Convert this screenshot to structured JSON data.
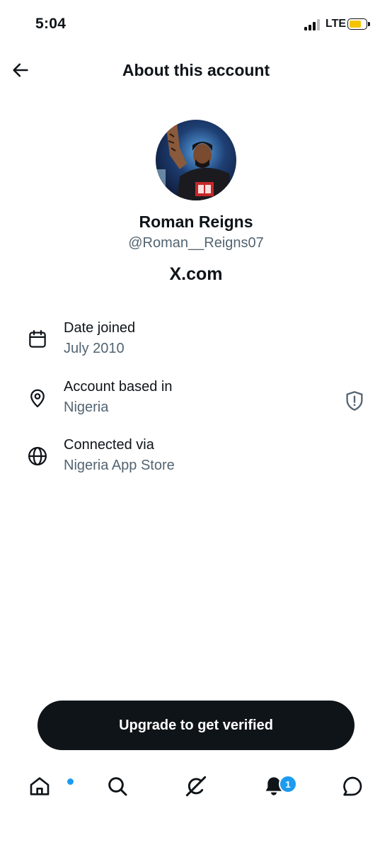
{
  "status_bar": {
    "time": "5:04",
    "network": "LTE",
    "battery_color": "#f5c400"
  },
  "header": {
    "title": "About this account",
    "back_icon": "arrow-left-icon"
  },
  "profile": {
    "display_name": "Roman Reigns",
    "handle": "@Roman__Reigns07",
    "platform": "X.com"
  },
  "info_items": [
    {
      "icon": "calendar-icon",
      "label": "Date joined",
      "value": "July 2010"
    },
    {
      "icon": "location-pin-icon",
      "label": "Account based in",
      "value": "Nigeria",
      "action_icon": "shield-alert-icon"
    },
    {
      "icon": "globe-icon",
      "label": "Connected via",
      "value": "Nigeria App Store"
    }
  ],
  "cta": {
    "label": "Upgrade to get verified"
  },
  "tab_bar": {
    "items": [
      "home-icon",
      "search-icon",
      "grok-icon",
      "bell-icon",
      "messages-icon"
    ],
    "notification_count": "1",
    "accent": "#1d9bf0"
  },
  "colors": {
    "primary_text": "#0f1419",
    "secondary_text": "#536471",
    "accent": "#1d9bf0"
  }
}
